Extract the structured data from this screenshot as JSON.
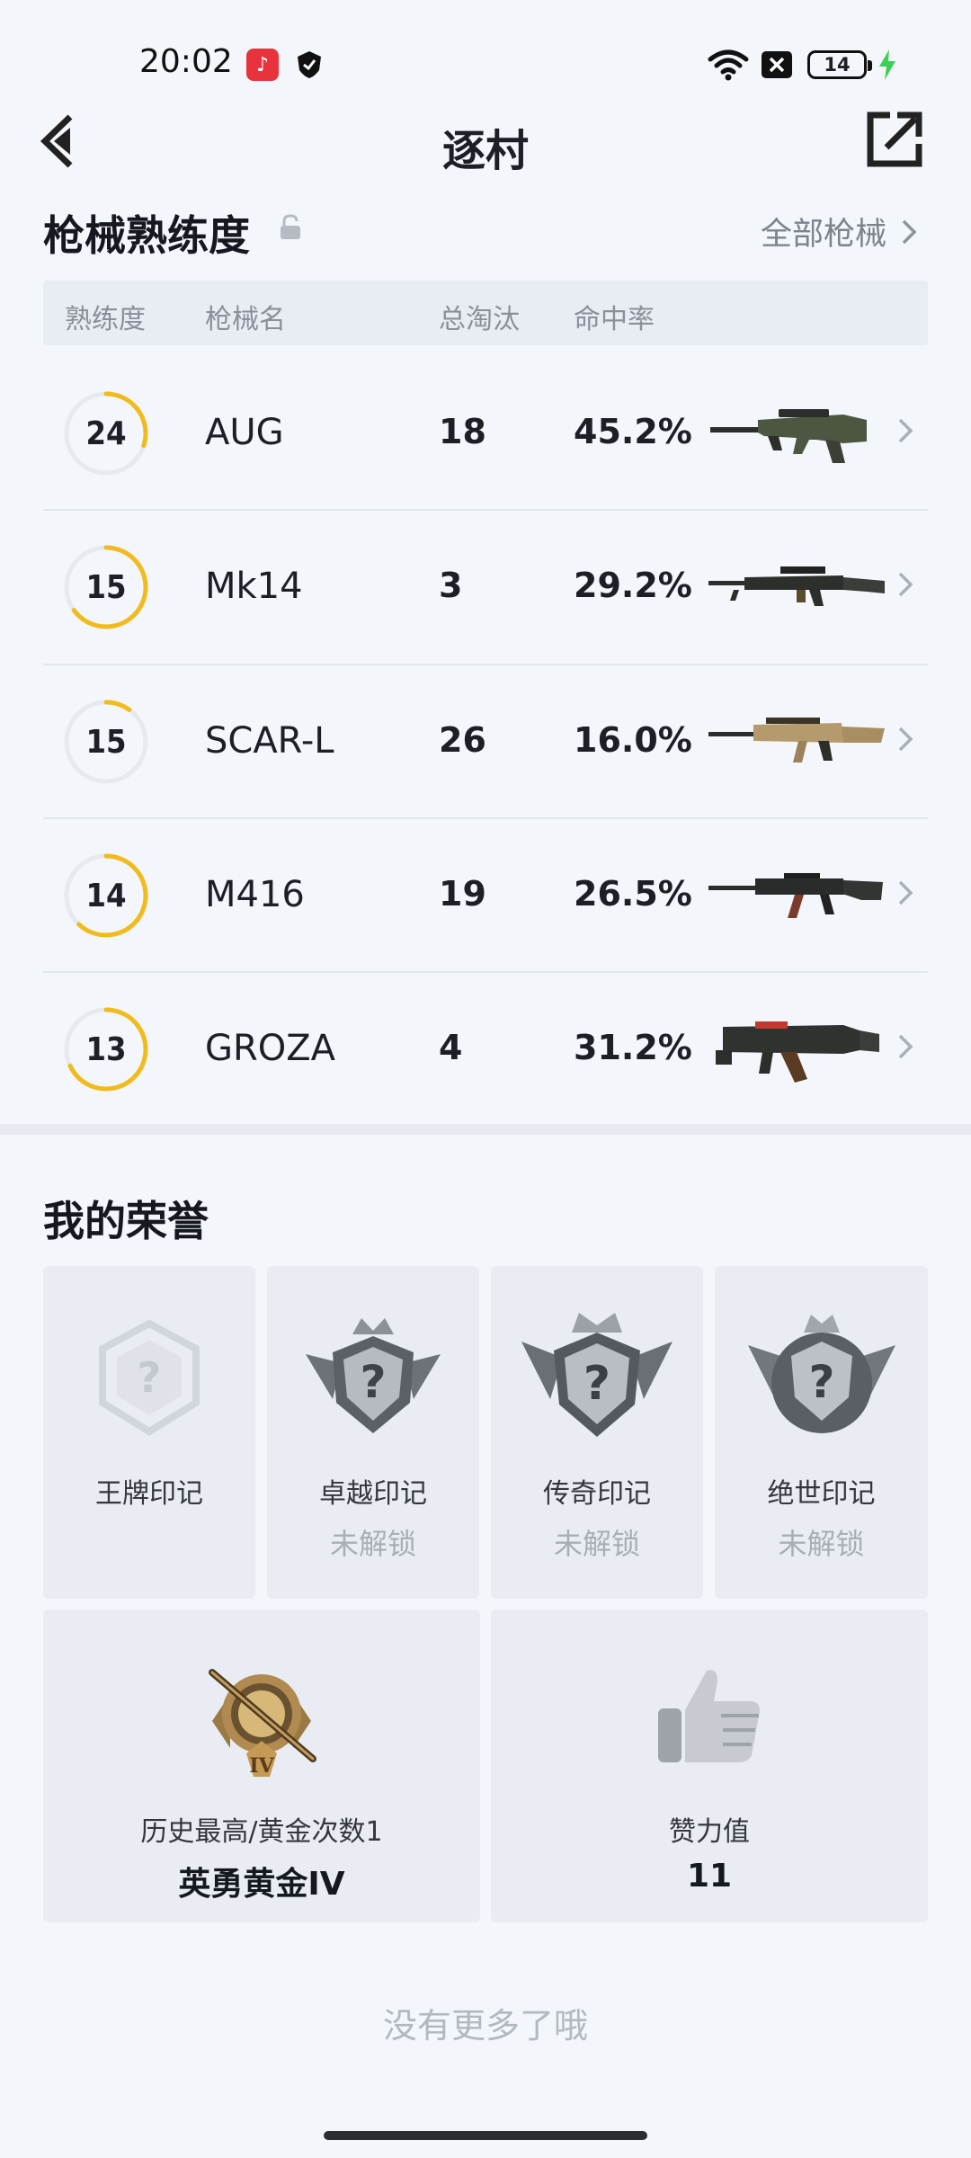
{
  "status_bar": {
    "time": "20:02",
    "battery_level": "14",
    "icons": [
      "music-app-icon",
      "shield-app-icon",
      "wifi-icon",
      "sim-off-icon",
      "battery-icon",
      "charging-icon"
    ]
  },
  "header": {
    "title": "逐村",
    "back_icon": "back-arrow-icon",
    "share_icon": "share-icon"
  },
  "weapon_section": {
    "title": "枪械熟练度",
    "lock_icon": "lock-icon",
    "all_link": "全部枪械",
    "columns": [
      "熟练度",
      "枪械名",
      "总淘汰",
      "命中率"
    ],
    "rows": [
      {
        "level": "24",
        "progress": 0.3,
        "name": "AUG",
        "kills": "18",
        "accuracy": "45.2%",
        "weapon_icon": "aug-rifle-icon"
      },
      {
        "level": "15",
        "progress": 0.65,
        "name": "Mk14",
        "kills": "3",
        "accuracy": "29.2%",
        "weapon_icon": "mk14-rifle-icon"
      },
      {
        "level": "15",
        "progress": 0.1,
        "name": "SCAR-L",
        "kills": "26",
        "accuracy": "16.0%",
        "weapon_icon": "scarl-rifle-icon"
      },
      {
        "level": "14",
        "progress": 0.62,
        "name": "M416",
        "kills": "19",
        "accuracy": "26.5%",
        "weapon_icon": "m416-rifle-icon"
      },
      {
        "level": "13",
        "progress": 0.68,
        "name": "GROZA",
        "kills": "4",
        "accuracy": "31.2%",
        "weapon_icon": "groza-rifle-icon"
      }
    ],
    "accent_color": "#f2bb1d"
  },
  "honor_section": {
    "title": "我的荣誉",
    "marks": [
      {
        "label": "王牌印记",
        "sub": "",
        "badge_icon": "ace-mark-badge-icon"
      },
      {
        "label": "卓越印记",
        "sub": "未解锁",
        "badge_icon": "excellence-mark-badge-icon"
      },
      {
        "label": "传奇印记",
        "sub": "未解锁",
        "badge_icon": "legend-mark-badge-icon"
      },
      {
        "label": "绝世印记",
        "sub": "未解锁",
        "badge_icon": "peerless-mark-badge-icon"
      }
    ],
    "rank": {
      "label": "历史最高/黄金次数1",
      "value": "英勇黄金IV",
      "badge_icon": "gold-rank-badge-icon"
    },
    "likes": {
      "label": "赞力值",
      "value": "11",
      "icon": "thumbs-up-icon"
    }
  },
  "footer": {
    "text": "没有更多了哦"
  }
}
